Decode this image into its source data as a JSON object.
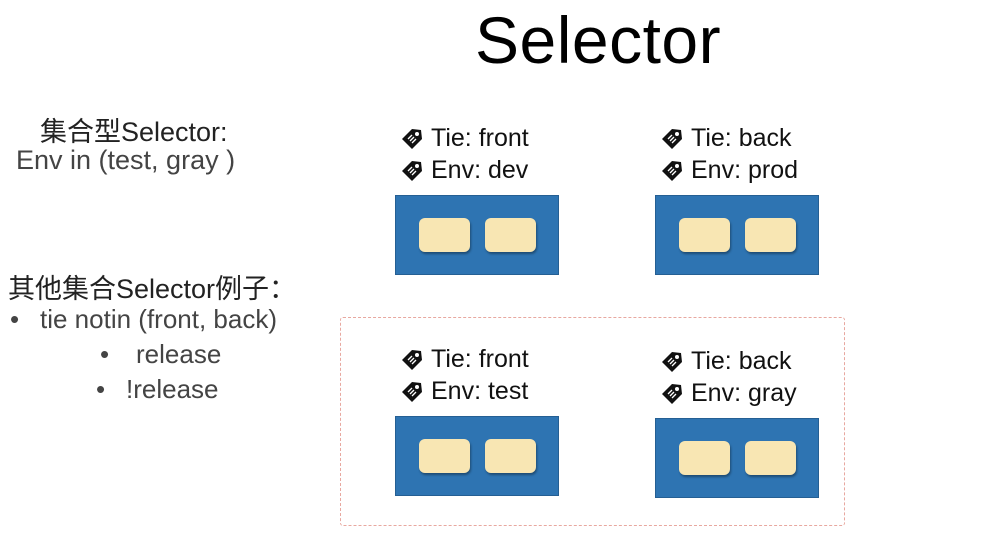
{
  "title": "Selector",
  "set_selector": {
    "heading": "集合型Selector:",
    "expression": "Env in (test, gray )"
  },
  "other_examples": {
    "heading": "其他集合Selector例子：",
    "items": [
      {
        "bullet": "•",
        "text": "tie notin (front, back)"
      },
      {
        "bullet": "•",
        "text": "release"
      },
      {
        "bullet": "•",
        "text": "!release"
      }
    ]
  },
  "nodes": [
    {
      "tie": "Tie: front",
      "env": "Env: dev",
      "selected": false
    },
    {
      "tie": "Tie: back",
      "env": "Env: prod",
      "selected": false
    },
    {
      "tie": "Tie: front",
      "env": "Env: test",
      "selected": true
    },
    {
      "tie": "Tie: back",
      "env": "Env: gray",
      "selected": true
    }
  ],
  "colors": {
    "node_fill": "#2e74b2",
    "pod_fill": "#f8e6b3",
    "selection_border": "#e8a8a0"
  },
  "icons": {
    "label_icon": "tag-icon"
  }
}
